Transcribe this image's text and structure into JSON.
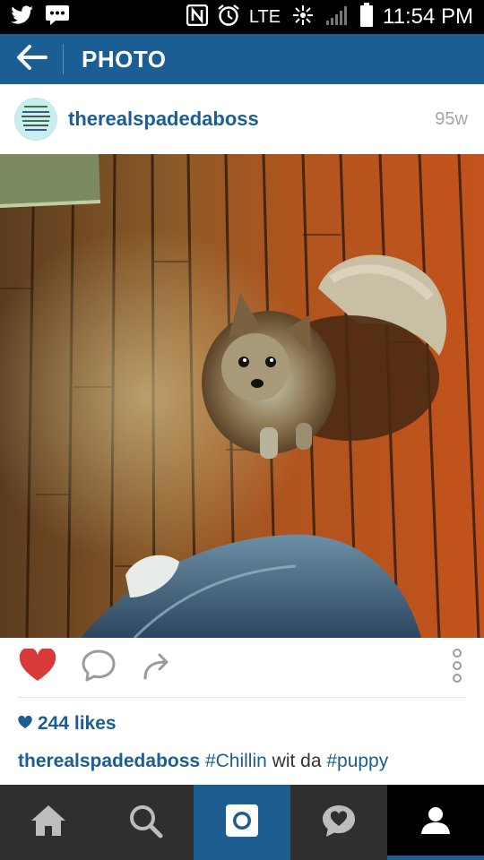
{
  "status_bar": {
    "network": "LTE",
    "clock": "11:54 PM",
    "icons": [
      "twitter-icon",
      "messages-icon",
      "nfc-icon",
      "alarm-icon",
      "lte-icon",
      "vibrate-icon",
      "signal-icon",
      "battery-icon"
    ]
  },
  "app_bar": {
    "title": "PHOTO",
    "back_icon": "arrow-left-icon",
    "background": "#1b5e93"
  },
  "post": {
    "username": "therealspadedaboss",
    "time_ago": "95w",
    "photo_description_icon": "photo",
    "actions": [
      "heart-icon",
      "comment-icon",
      "share-icon",
      "more-options-icon"
    ],
    "liked": true,
    "likes_text": "244 likes",
    "caption": {
      "username": "therealspadedaboss",
      "tag1": "#Chillin",
      "text": " wit da ",
      "tag2": "#puppy"
    }
  },
  "bottom_nav": {
    "items": [
      "home-icon",
      "search-icon",
      "camera-icon",
      "activity-icon",
      "profile-icon"
    ],
    "active": "profile"
  },
  "colors": {
    "brand_blue": "#1b5e93",
    "like_red": "#d83a3a",
    "nav_bg": "#2f2f2f"
  }
}
